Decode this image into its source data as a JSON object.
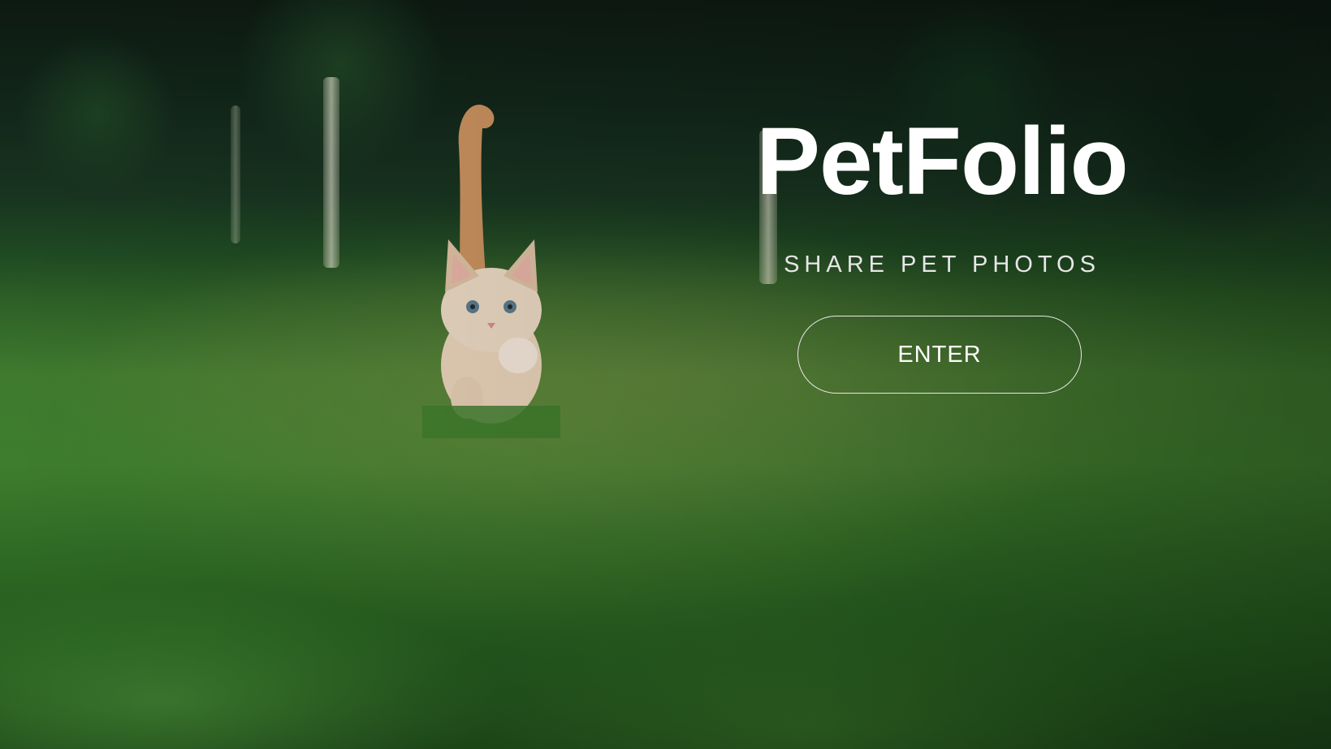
{
  "hero": {
    "title": "PetFolio",
    "subtitle": "SHARE PET PHOTOS",
    "enter_label": "ENTER",
    "background_image": "kitten-running-in-grass-photo"
  },
  "colors": {
    "title_text": "#ffffff",
    "subtitle_text": "#e6e6e6",
    "button_border": "#e8e8e8",
    "grass_green": "#3f7a2e",
    "forest_dark": "#0d1a12"
  }
}
